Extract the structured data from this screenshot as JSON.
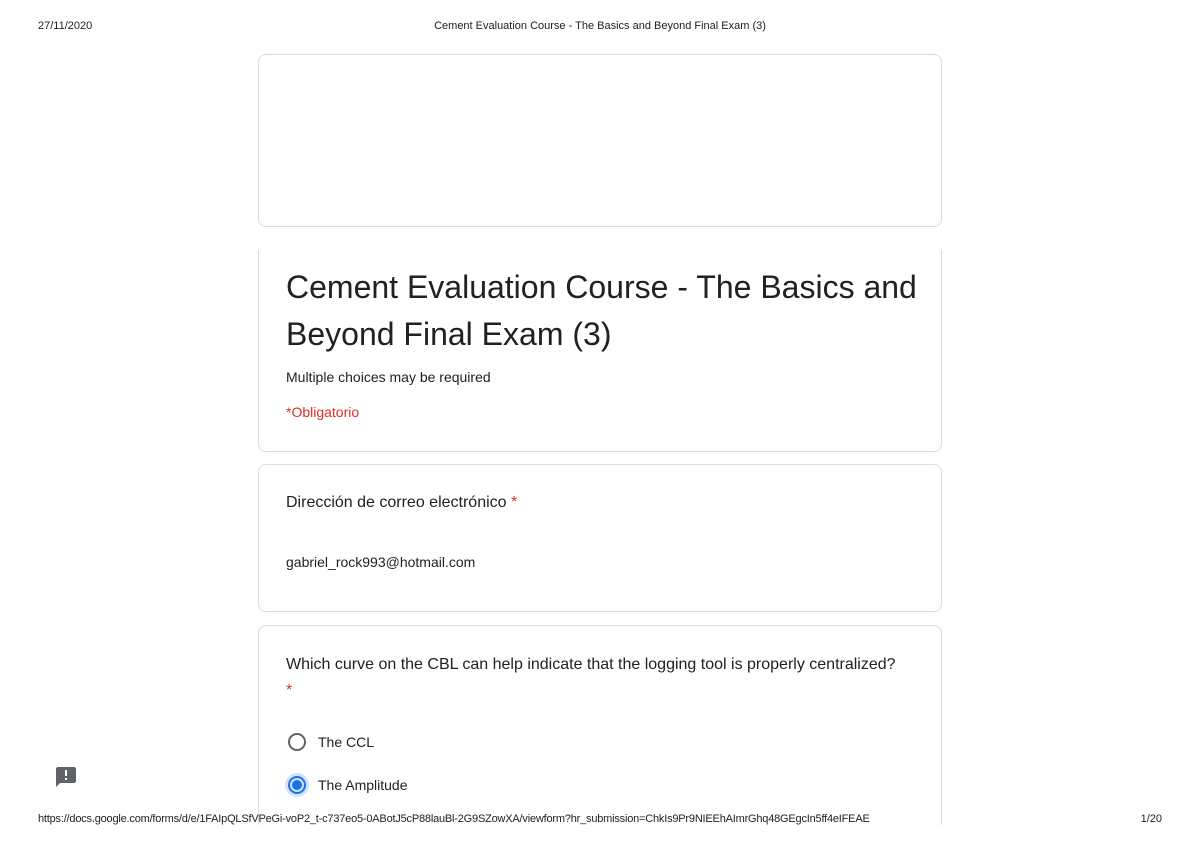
{
  "print_header": {
    "date": "27/11/2020",
    "title": "Cement Evaluation Course - The Basics and Beyond Final Exam (3)"
  },
  "form": {
    "title": "Cement Evaluation Course - The Basics and Beyond Final Exam (3)",
    "description": "Multiple choices may be required",
    "required_note": "*Obligatorio"
  },
  "email_question": {
    "label": "Dirección de correo electrónico",
    "required_mark": "*",
    "answer": "gabriel_rock993@hotmail.com"
  },
  "question_1": {
    "label": "Which curve on the CBL can help indicate that the logging tool is properly centralized?",
    "required_mark": "*",
    "options": [
      {
        "label": "The CCL",
        "selected": false
      },
      {
        "label": "The Amplitude",
        "selected": true
      }
    ]
  },
  "print_footer": {
    "url": "https://docs.google.com/forms/d/e/1FAIpQLSfVPeGi-voP2_t-c737eo5-0ABotJ5cP88lauBl-2G9SZowXA/viewform?hr_submission=ChkIs9Pr9NIEEhAImrGhq48GEgcIn5ff4eIFEAE",
    "page": "1/20"
  },
  "colors": {
    "accent": "#1a73e8",
    "required": "#d93025",
    "border": "#dadce0"
  },
  "icons": {
    "feedback": "feedback-icon"
  }
}
